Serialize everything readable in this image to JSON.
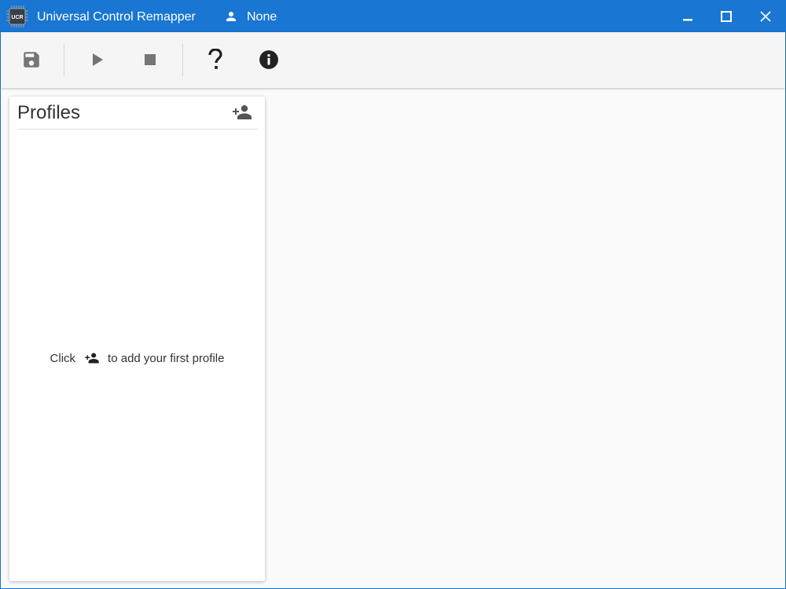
{
  "window": {
    "title": "Universal Control Remapper",
    "app_icon_text": "UCR",
    "user": "None",
    "accent": "#1976d2"
  },
  "toolbar": {
    "buttons": [
      {
        "icon": "save-icon",
        "label": "Save"
      },
      {
        "icon": "play-icon",
        "label": "Start"
      },
      {
        "icon": "stop-icon",
        "label": "Stop"
      },
      {
        "icon": "help-icon",
        "label": "Help"
      },
      {
        "icon": "info-icon",
        "label": "About"
      }
    ]
  },
  "profiles": {
    "title": "Profiles",
    "add_icon": "add-person-icon",
    "empty_prefix": "Click",
    "empty_suffix": "to add your first profile"
  }
}
